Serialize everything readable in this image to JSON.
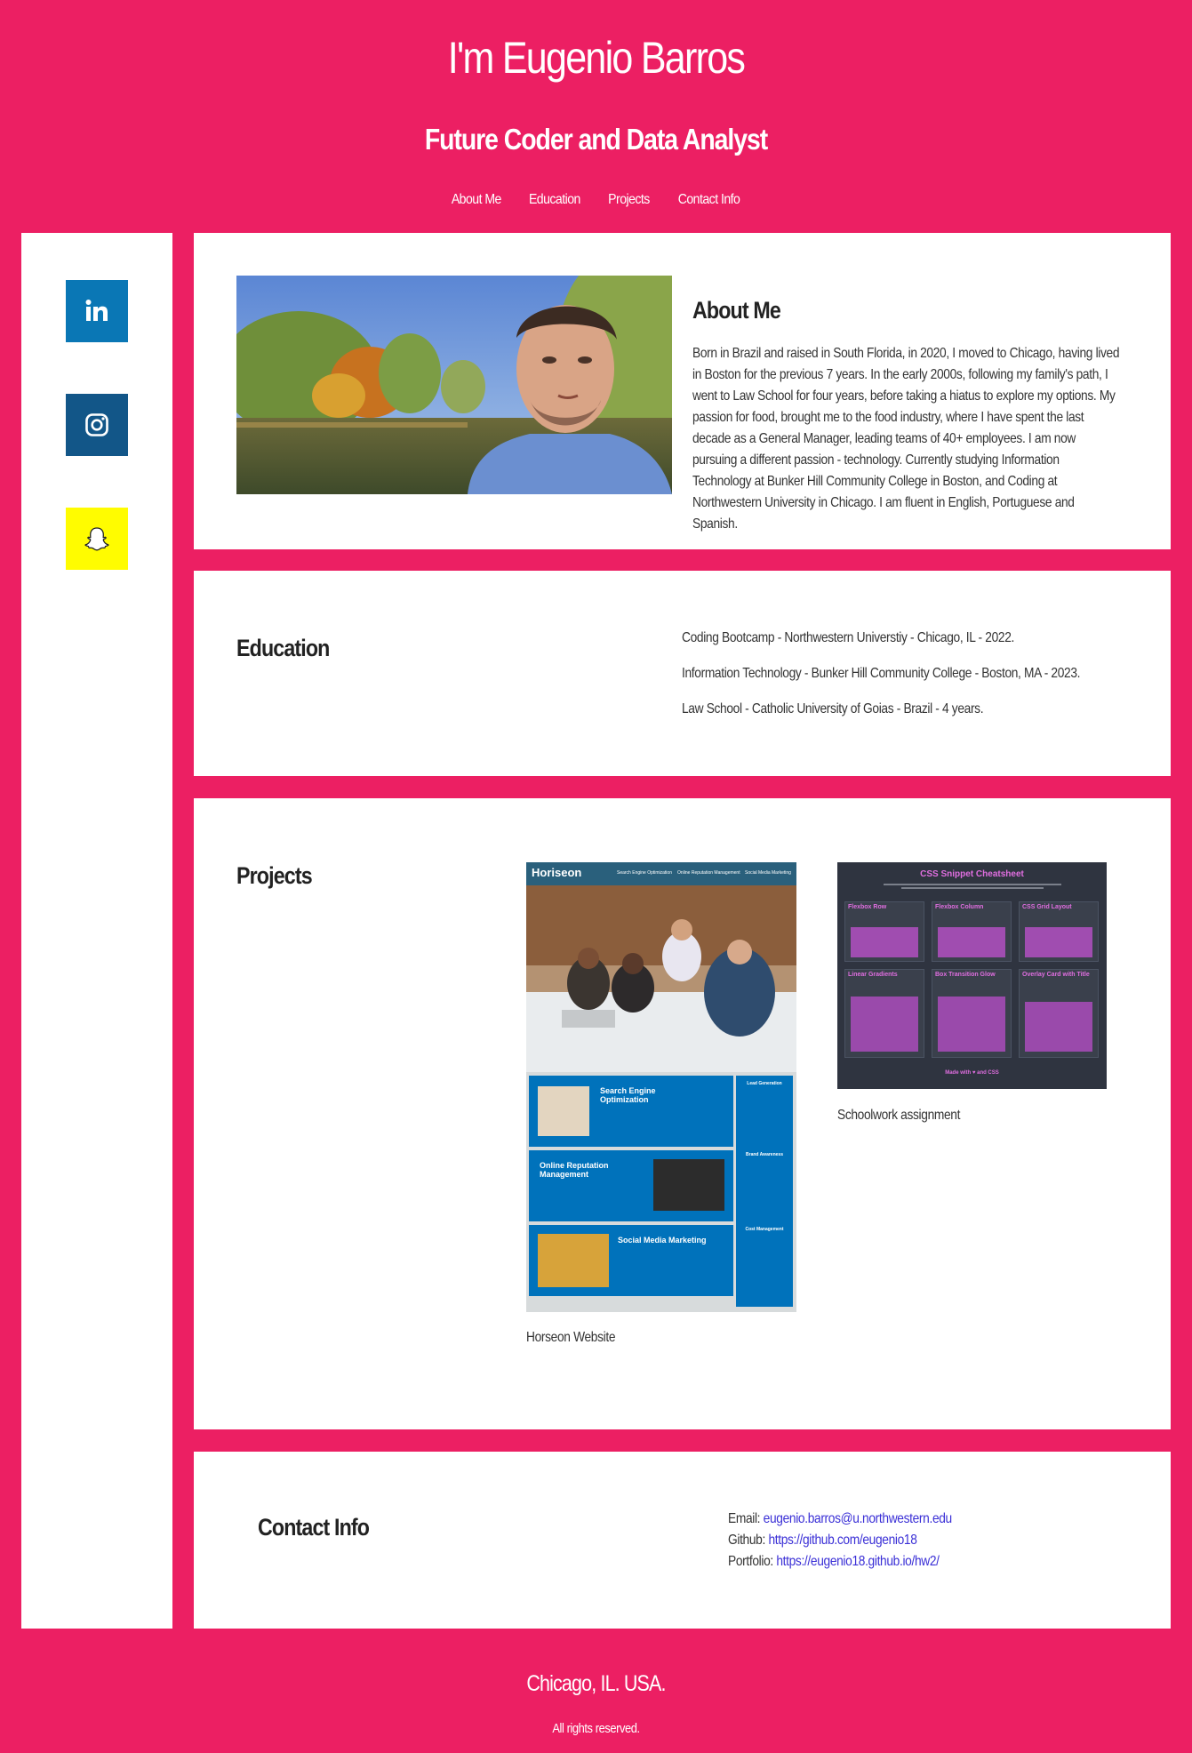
{
  "header": {
    "title": "I'm Eugenio Barros",
    "subtitle": "Future Coder and Data Analyst"
  },
  "nav": {
    "items": [
      {
        "label": "About Me"
      },
      {
        "label": "Education"
      },
      {
        "label": "Projects"
      },
      {
        "label": "Contact Info"
      }
    ]
  },
  "sidebar": {
    "social": [
      {
        "icon": "linkedin-icon",
        "color": "#0a77b5"
      },
      {
        "icon": "instagram-icon",
        "color": "#125688"
      },
      {
        "icon": "snapchat-icon",
        "color": "#fffc00"
      }
    ]
  },
  "about": {
    "heading": "About Me",
    "text": "Born in Brazil and raised in South Florida, in 2020, I moved to Chicago, having lived in Boston for the previous 7 years. In the early 2000s, following my family's path, I went to Law School for four years, before taking a hiatus to explore my options. My passion for food, brought me to the food industry, where I have spent the last decade as a General Manager, leading teams of 40+ employees. I am now pursuing a different passion - technology. Currently studying Information Technology at Bunker Hill Community College in Boston, and Coding at Northwestern University in Chicago. I am fluent in English, Portuguese and Spanish."
  },
  "education": {
    "heading": "Education",
    "items": [
      "Coding Bootcamp - Northwestern Universtiy - Chicago, IL - 2022.",
      "Information Technology - Bunker Hill Community College - Boston, MA - 2023.",
      "Law School - Catholic University of Goias - Brazil - 4 years."
    ]
  },
  "projects": {
    "heading": "Projects",
    "items": [
      {
        "caption": "Horseon Website",
        "thumb": {
          "brand": "Horiseon",
          "nav": [
            "Search Engine Optimization",
            "Online Reputation Management",
            "Social Media Marketing"
          ],
          "cards": [
            "Search Engine Optimization",
            "Online Reputation Management",
            "Social Media Marketing"
          ],
          "side": [
            "Lead Generation",
            "Brand Awareness",
            "Cost Management"
          ]
        }
      },
      {
        "caption": "Schoolwork assignment",
        "thumb": {
          "title": "CSS Snippet Cheatsheet",
          "cards": [
            "Flexbox Row",
            "Flexbox Column",
            "CSS Grid Layout",
            "Linear Gradients",
            "Box Transition Glow",
            "Overlay Card with Title"
          ],
          "footer": "Made with ♥ and CSS"
        }
      }
    ]
  },
  "contact": {
    "heading": "Contact Info",
    "email_label": "Email: ",
    "email": "eugenio.barros@u.northwestern.edu",
    "github_label": "Github: ",
    "github": "https://github.com/eugenio18",
    "portfolio_label": "Portfolio: ",
    "portfolio": "https://eugenio18.github.io/hw2/"
  },
  "footer": {
    "city": "Chicago, IL. USA.",
    "rights": "All rights reserved."
  },
  "colors": {
    "background": "#ec1f63",
    "link": "#3a2fd6"
  }
}
